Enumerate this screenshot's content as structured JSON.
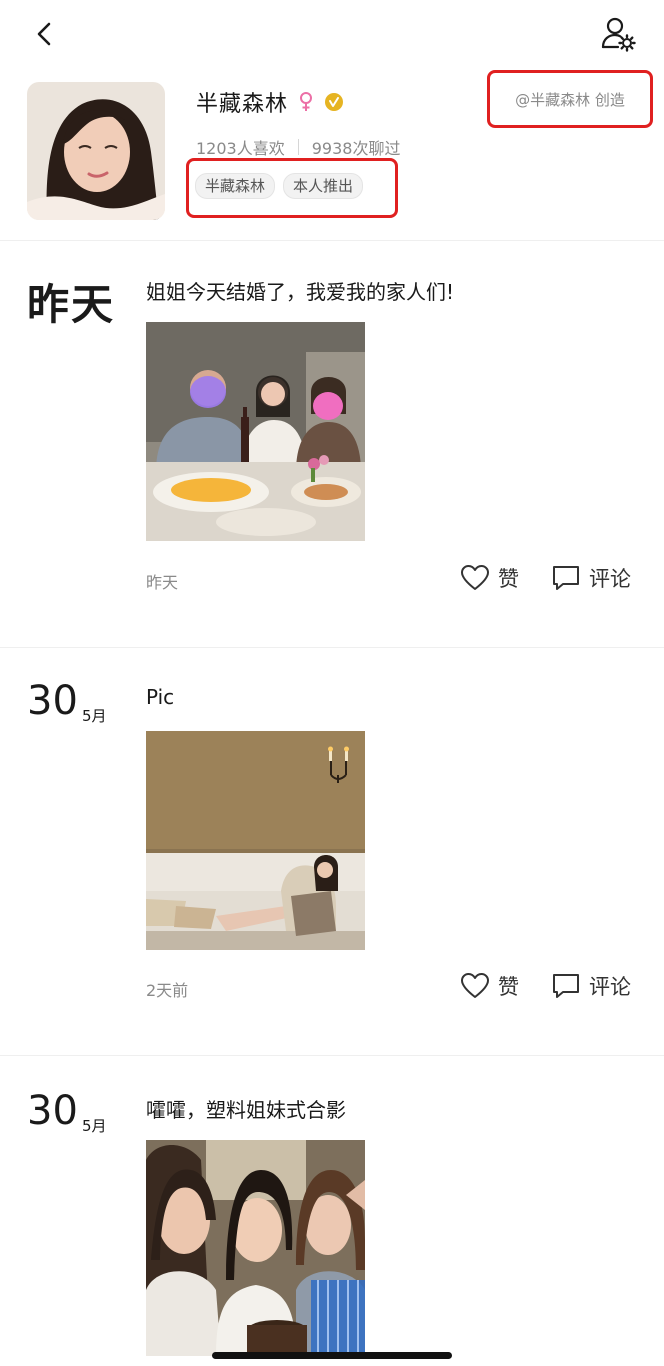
{
  "header": {
    "back_icon": "chevron-left-icon",
    "settings_icon": "user-settings-icon"
  },
  "profile": {
    "name": "半藏森林",
    "gender_icon": "female-icon",
    "verified_icon": "verified-badge-icon",
    "likes": "1203人喜欢",
    "chats": "9938次聊过",
    "tags": [
      "半藏森林",
      "本人推出"
    ],
    "creator": "@半藏森林 创造",
    "accent_color": "#e02020",
    "verified_color": "#e6b422",
    "female_color": "#ec6fa6"
  },
  "posts": [
    {
      "date_label": "昨天",
      "text": "姐姐今天结婚了，我爱我的家人们!",
      "time": "昨天",
      "like_label": "赞",
      "comment_label": "评论",
      "photo": "family-dinner-photo"
    },
    {
      "date_day": "30",
      "date_month": "5月",
      "text": "Pic",
      "time": "2天前",
      "like_label": "赞",
      "comment_label": "评论",
      "photo": "sofa-photo"
    },
    {
      "date_day": "30",
      "date_month": "5月",
      "text": "嚯嚯，塑料姐妹式合影",
      "photo": "friends-selfie-photo"
    }
  ]
}
